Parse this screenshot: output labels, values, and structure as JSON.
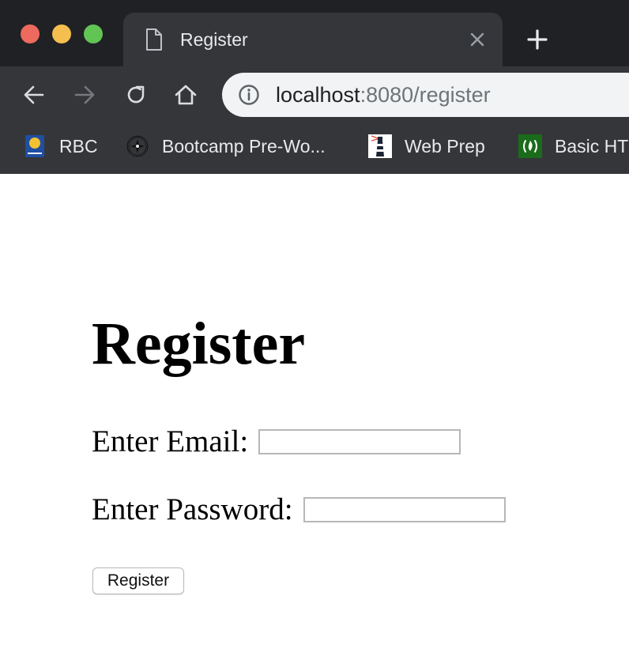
{
  "tab": {
    "title": "Register"
  },
  "omnibox": {
    "host": "localhost",
    "rest": ":8080/register"
  },
  "bookmarks": [
    {
      "label": "RBC",
      "icon": "rbc-logo-icon"
    },
    {
      "label": "Bootcamp Pre-Wo...",
      "icon": "compass-icon"
    },
    {
      "label": "Web Prep",
      "icon": "lighthouse-icon"
    },
    {
      "label": "Basic HT",
      "icon": "freecodecamp-icon"
    }
  ],
  "page": {
    "title": "Register",
    "email_label": "Enter Email:",
    "email_value": "",
    "password_label": "Enter Password:",
    "password_value": "",
    "submit_label": "Register"
  },
  "colors": {
    "tab_strip": "#202124",
    "toolbar": "#35363a",
    "omnibox": "#f1f3f4",
    "close_red": "#ed6a5e",
    "minimize_yellow": "#f5bf4f",
    "zoom_green": "#61c454"
  }
}
